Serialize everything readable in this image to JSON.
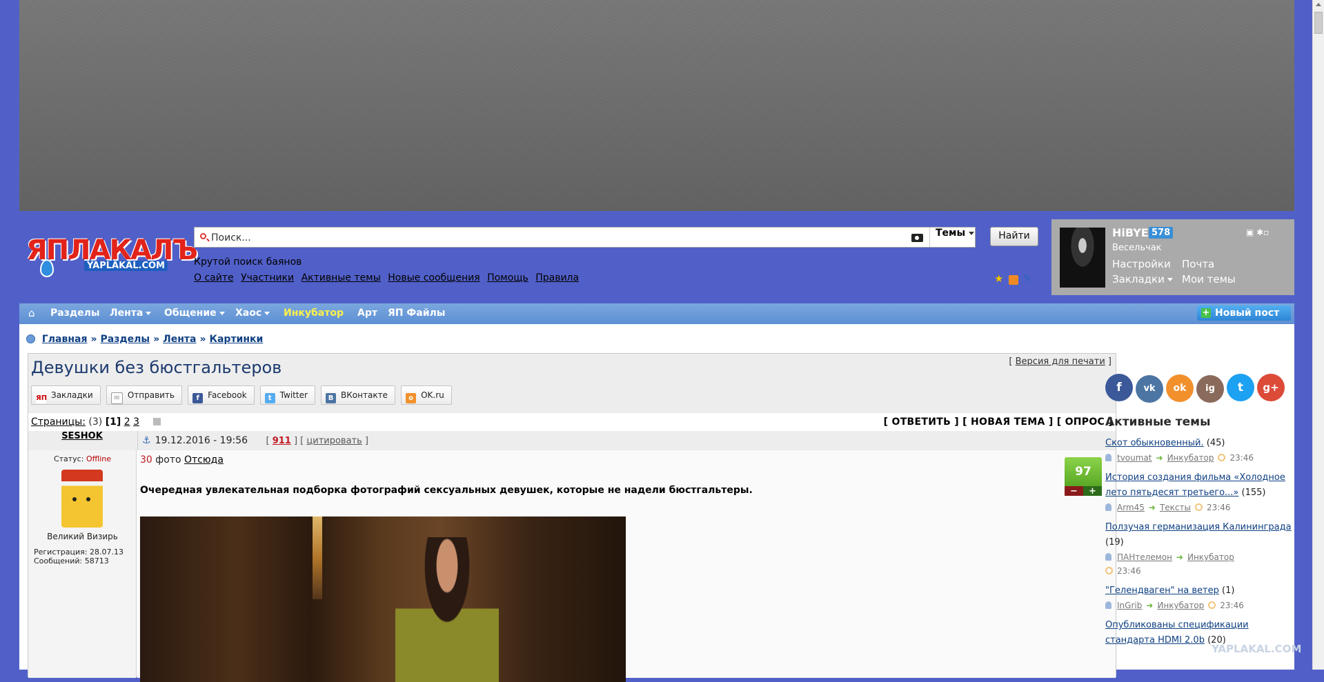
{
  "header": {
    "logo_main": "ЯПЛАКАЛЪ",
    "logo_sub": "YAPLAKAL.COM",
    "search": {
      "placeholder": "Поиск...",
      "scope": "Темы",
      "button": "Найти",
      "hint": "Крутой поиск баянов"
    },
    "links": [
      "О сайте",
      "Участники",
      "Активные темы",
      "Новые сообщения",
      "Помощь",
      "Правила"
    ]
  },
  "user": {
    "name": "HiBYE",
    "count": "578",
    "rank": "Весельчак",
    "settings": "Настройки",
    "mail": "Почта",
    "bookmarks": "Закладки",
    "my_topics": "Мои темы"
  },
  "nav": {
    "items": [
      "Разделы",
      "Лента",
      "Общение",
      "Хаос",
      "Инкубатор",
      "Арт",
      "ЯП Файлы"
    ],
    "new_post": "Новый пост"
  },
  "breadcrumb": [
    "Главная",
    "Картинки",
    "Лента",
    "Разделы"
  ],
  "topic": {
    "title": "Девушки без бюстгальтеров",
    "print_link": "Версия для печати",
    "share": [
      "Закладки",
      "Отправить",
      "Facebook",
      "Twitter",
      "ВКонтакте",
      "OK.ru"
    ],
    "pages_label": "Страницы:",
    "pages_count": "(3)",
    "pages": [
      "[1]",
      "2",
      "3"
    ],
    "actions": "[ ОТВЕТИТЬ ] [ НОВАЯ ТЕМА ] [ ОПРОС ]"
  },
  "post": {
    "author": "SESHOK",
    "datetime": "19.12.2016 - 19:56",
    "reply_count": "911",
    "quote": "цитировать",
    "status_label": "Статус:",
    "status": "Offline",
    "author_rank": "Великий Визирь",
    "registration": "Регистрация: 28.07.13",
    "messages": "Сообщений: 58713",
    "photo_count": "30",
    "photo_word": "фото",
    "source": "Отсюда",
    "description": "Очередная увлекательная подборка фотографий сексуальных девушек, которые не надели бюстгальтеры.",
    "score": "97",
    "vote_minus": "−",
    "vote_plus": "+"
  },
  "sidebar": {
    "social": [
      "f",
      "vk",
      "ok",
      "ig",
      "t",
      "g+"
    ],
    "title": "Активные темы",
    "topics": [
      {
        "title": "Скот обыкновенный.",
        "count": "(45)",
        "user": "tvoumat",
        "section": "Инкубатор",
        "time": "23:46"
      },
      {
        "title": "История создания фильма «Холодное лето пятьдесят третьего...»",
        "count": "(155)",
        "user": "Arm45",
        "section": "Тексты",
        "time": "23:46"
      },
      {
        "title": "Ползучая германизация Калининграда",
        "count": "(19)",
        "user": "ПАНтелемон",
        "section": "Инкубатор",
        "time": "23:46"
      },
      {
        "title": "\"Гелендваген\" на ветер",
        "count": "(1)",
        "user": "InGrib",
        "section": "Инкубатор",
        "time": "23:46"
      },
      {
        "title": "Опубликованы спецификации стандарта HDMI 2.0b",
        "count": "(20)",
        "user": "",
        "section": "",
        "time": ""
      }
    ]
  },
  "watermark": "YAPLAKAL.COM"
}
